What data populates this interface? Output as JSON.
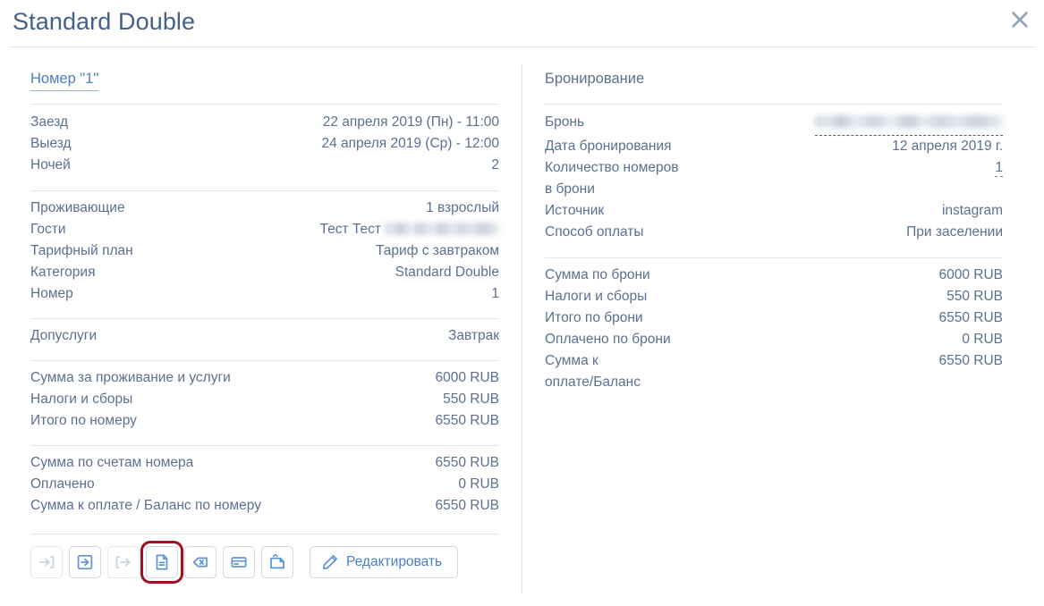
{
  "header": {
    "title": "Standard Double",
    "close_icon": "close-icon"
  },
  "left": {
    "room_link": "Номер \"1\"",
    "stay": [
      {
        "label": "Заезд",
        "value": "22 апреля 2019 (Пн) - 11:00"
      },
      {
        "label": "Выезд",
        "value": "24 апреля 2019 (Ср) - 12:00"
      },
      {
        "label": "Ночей",
        "value": "2"
      }
    ],
    "occupancy": [
      {
        "label": "Проживающие",
        "value": "1 взрослый"
      },
      {
        "label": "Гости",
        "value": "Тест Тест",
        "redacted": true
      },
      {
        "label": "Тарифный план",
        "value": "Тариф с завтраком"
      },
      {
        "label": "Категория",
        "value": "Standard Double"
      },
      {
        "label": "Номер",
        "value": "1"
      }
    ],
    "extras": [
      {
        "label": "Допуслуги",
        "value": "Завтрак"
      }
    ],
    "room_totals": [
      {
        "label": "Сумма за проживание и услуги",
        "value": "6000 RUB"
      },
      {
        "label": "Налоги и сборы",
        "value": "550 RUB"
      },
      {
        "label": "Итого по номеру",
        "value": "6550 RUB"
      }
    ],
    "room_balance": [
      {
        "label": "Сумма по счетам номера",
        "value": "6550 RUB"
      },
      {
        "label": "Оплачено",
        "value": "0 RUB"
      },
      {
        "label": "Сумма к оплате / Баланс по номеру",
        "value": "6550 RUB"
      }
    ]
  },
  "right": {
    "heading": "Бронирование",
    "booking": [
      {
        "label": "Бронь",
        "value": "",
        "redacted": true
      },
      {
        "label": "Дата бронирования",
        "value": "12 апреля 2019 г."
      },
      {
        "label": "Количество номеров\nв брони",
        "value": "1",
        "dotted": true
      },
      {
        "label": "Источник",
        "value": "instagram"
      },
      {
        "label": "Способ оплаты",
        "value": "При заселении"
      }
    ],
    "totals": [
      {
        "label": "Сумма по брони",
        "value": "6000 RUB"
      },
      {
        "label": "Налоги и сборы",
        "value": "550 RUB"
      },
      {
        "label": "Итого по брони",
        "value": "6550 RUB"
      },
      {
        "label": "Оплачено по брони",
        "value": "0 RUB"
      },
      {
        "label": "Сумма к\nоплате/Баланс",
        "value": "6550 RUB"
      }
    ]
  },
  "toolbar": {
    "buttons": [
      {
        "name": "check-in-icon",
        "icon": "arrow-into-bracket",
        "enabled": false,
        "highlighted": false
      },
      {
        "name": "check-out-icon",
        "icon": "arrow-out-box",
        "enabled": true,
        "highlighted": false
      },
      {
        "name": "early-departure-icon",
        "icon": "arrow-out-bracket",
        "enabled": false,
        "highlighted": false
      },
      {
        "name": "document-icon",
        "icon": "document",
        "enabled": true,
        "highlighted": true
      },
      {
        "name": "cancel-tag-icon",
        "icon": "tag-cancel",
        "enabled": true,
        "highlighted": false
      },
      {
        "name": "payment-card-icon",
        "icon": "credit-card",
        "enabled": true,
        "highlighted": false
      },
      {
        "name": "note-tag-icon",
        "icon": "note-tag",
        "enabled": true,
        "highlighted": false
      }
    ],
    "edit_label": "Редактировать",
    "edit_icon": "pencil-icon"
  },
  "colors": {
    "text": "#5b7091",
    "title": "#44618a",
    "link": "#4a7dc4",
    "icon": "#5d93d6",
    "icon_disabled": "#c9d2de",
    "border": "#cfd8e4",
    "rule": "#e2e6eb",
    "highlight": "#9b1220"
  }
}
